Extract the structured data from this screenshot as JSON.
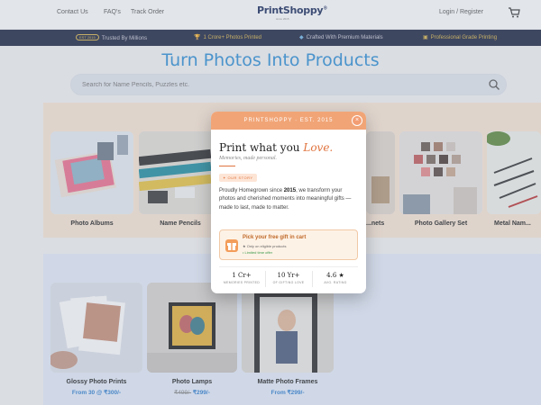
{
  "header": {
    "nav": [
      "Contact Us",
      "FAQ's",
      "Track Order"
    ],
    "logo": "PrintShoppy",
    "logo_mark": "®",
    "logo_tagline": "since 2015",
    "login": "Login / Register",
    "cart_icon": "cart-icon"
  },
  "trust_bar": {
    "since_badge": "EST 2015",
    "items": [
      "Trusted By Millions",
      "1 Crore+ Photos Printed",
      "Crafted With Premium Materials",
      "Professional Grade Printing"
    ]
  },
  "main": {
    "title": "Turn Photos Into Products",
    "search_placeholder": "Search for Name Pencils, Puzzles etc.",
    "row1": [
      {
        "label": "Photo Albums"
      },
      {
        "label": "Name Pencils"
      },
      {
        "label": "...nets"
      },
      {
        "label": "Photo Gallery Set"
      },
      {
        "label": "Metal Nam..."
      }
    ],
    "row2": [
      {
        "label": "Glossy Photo Prints",
        "price_prefix": "From 30 @ ",
        "price": "₹300/-"
      },
      {
        "label": "Photo Lamps",
        "old_price": "₹499/-",
        "price": "₹299/-"
      },
      {
        "label": "Matte Photo Frames",
        "price_prefix": "From ",
        "price": "₹299/-"
      }
    ]
  },
  "modal": {
    "header": "PRINTSHOPPY · EST. 2015",
    "close": "×",
    "title_main": "Print what you ",
    "title_accent": "Love.",
    "subtitle": "Memories, made personal.",
    "story_pill": "✦ OUR STORY",
    "body_pre": "Proudly Homegrown since ",
    "body_year": "2015",
    "body_post": ", we transform your photos and cherished moments into meaningful gifts — made to last, made to matter.",
    "gift": {
      "title": "Pick your free gift in cart",
      "line1": "★ Only on eligible products",
      "line2": "• Limited time offer"
    },
    "stats": [
      {
        "value": "1 Cr+",
        "label": "MEMORIES PRINTED"
      },
      {
        "value": "10 Yr+",
        "label": "OF GIFTING LOVE"
      },
      {
        "value": "4.6 ★",
        "label": "AVG. RATING"
      }
    ]
  },
  "colors": {
    "accent": "#2f8fd6",
    "modal_header": "#f1a577",
    "trust_bar": "#1c2540",
    "gold": "#d9b54a"
  }
}
